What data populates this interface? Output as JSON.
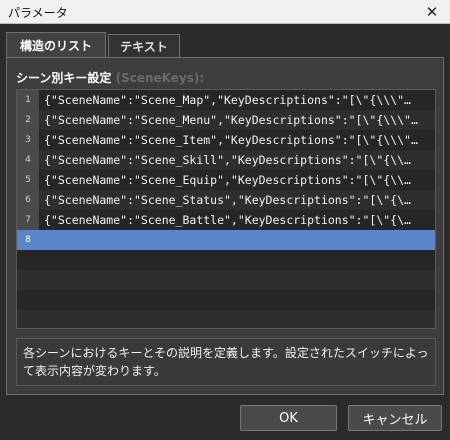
{
  "window": {
    "title": "パラメータ"
  },
  "tabs": [
    {
      "label": "構造のリスト"
    },
    {
      "label": "テキスト"
    }
  ],
  "section": {
    "label": "シーン別キー設定",
    "key": "(SceneKeys):"
  },
  "editor": {
    "lines": [
      {
        "num": "1",
        "text": "{\"SceneName\":\"Scene_Map\",\"KeyDescriptions\":\"[\\\"{\\\\\\\"…"
      },
      {
        "num": "2",
        "text": "{\"SceneName\":\"Scene_Menu\",\"KeyDescriptions\":\"[\\\"{\\\\\\\"…"
      },
      {
        "num": "3",
        "text": "{\"SceneName\":\"Scene_Item\",\"KeyDescriptions\":\"[\\\"{\\\\\\\"…"
      },
      {
        "num": "4",
        "text": "{\"SceneName\":\"Scene_Skill\",\"KeyDescriptions\":\"[\\\"{\\\\…"
      },
      {
        "num": "5",
        "text": "{\"SceneName\":\"Scene_Equip\",\"KeyDescriptions\":\"[\\\"{\\\\…"
      },
      {
        "num": "6",
        "text": "{\"SceneName\":\"Scene_Status\",\"KeyDescriptions\":\"[\\\"{\\…"
      },
      {
        "num": "7",
        "text": "{\"SceneName\":\"Scene_Battle\",\"KeyDescriptions\":\"[\\\"{\\…"
      },
      {
        "num": "8",
        "text": ""
      }
    ]
  },
  "description": "各シーンにおけるキーとその説明を定義します。設定されたスイッチによって表示内容が変わります。",
  "buttons": {
    "ok": "OK",
    "cancel": "キャンセル"
  },
  "icons": {
    "close": "close-icon"
  },
  "colors": {
    "selection": "#5b85c9",
    "background": "#2b2b2b"
  }
}
